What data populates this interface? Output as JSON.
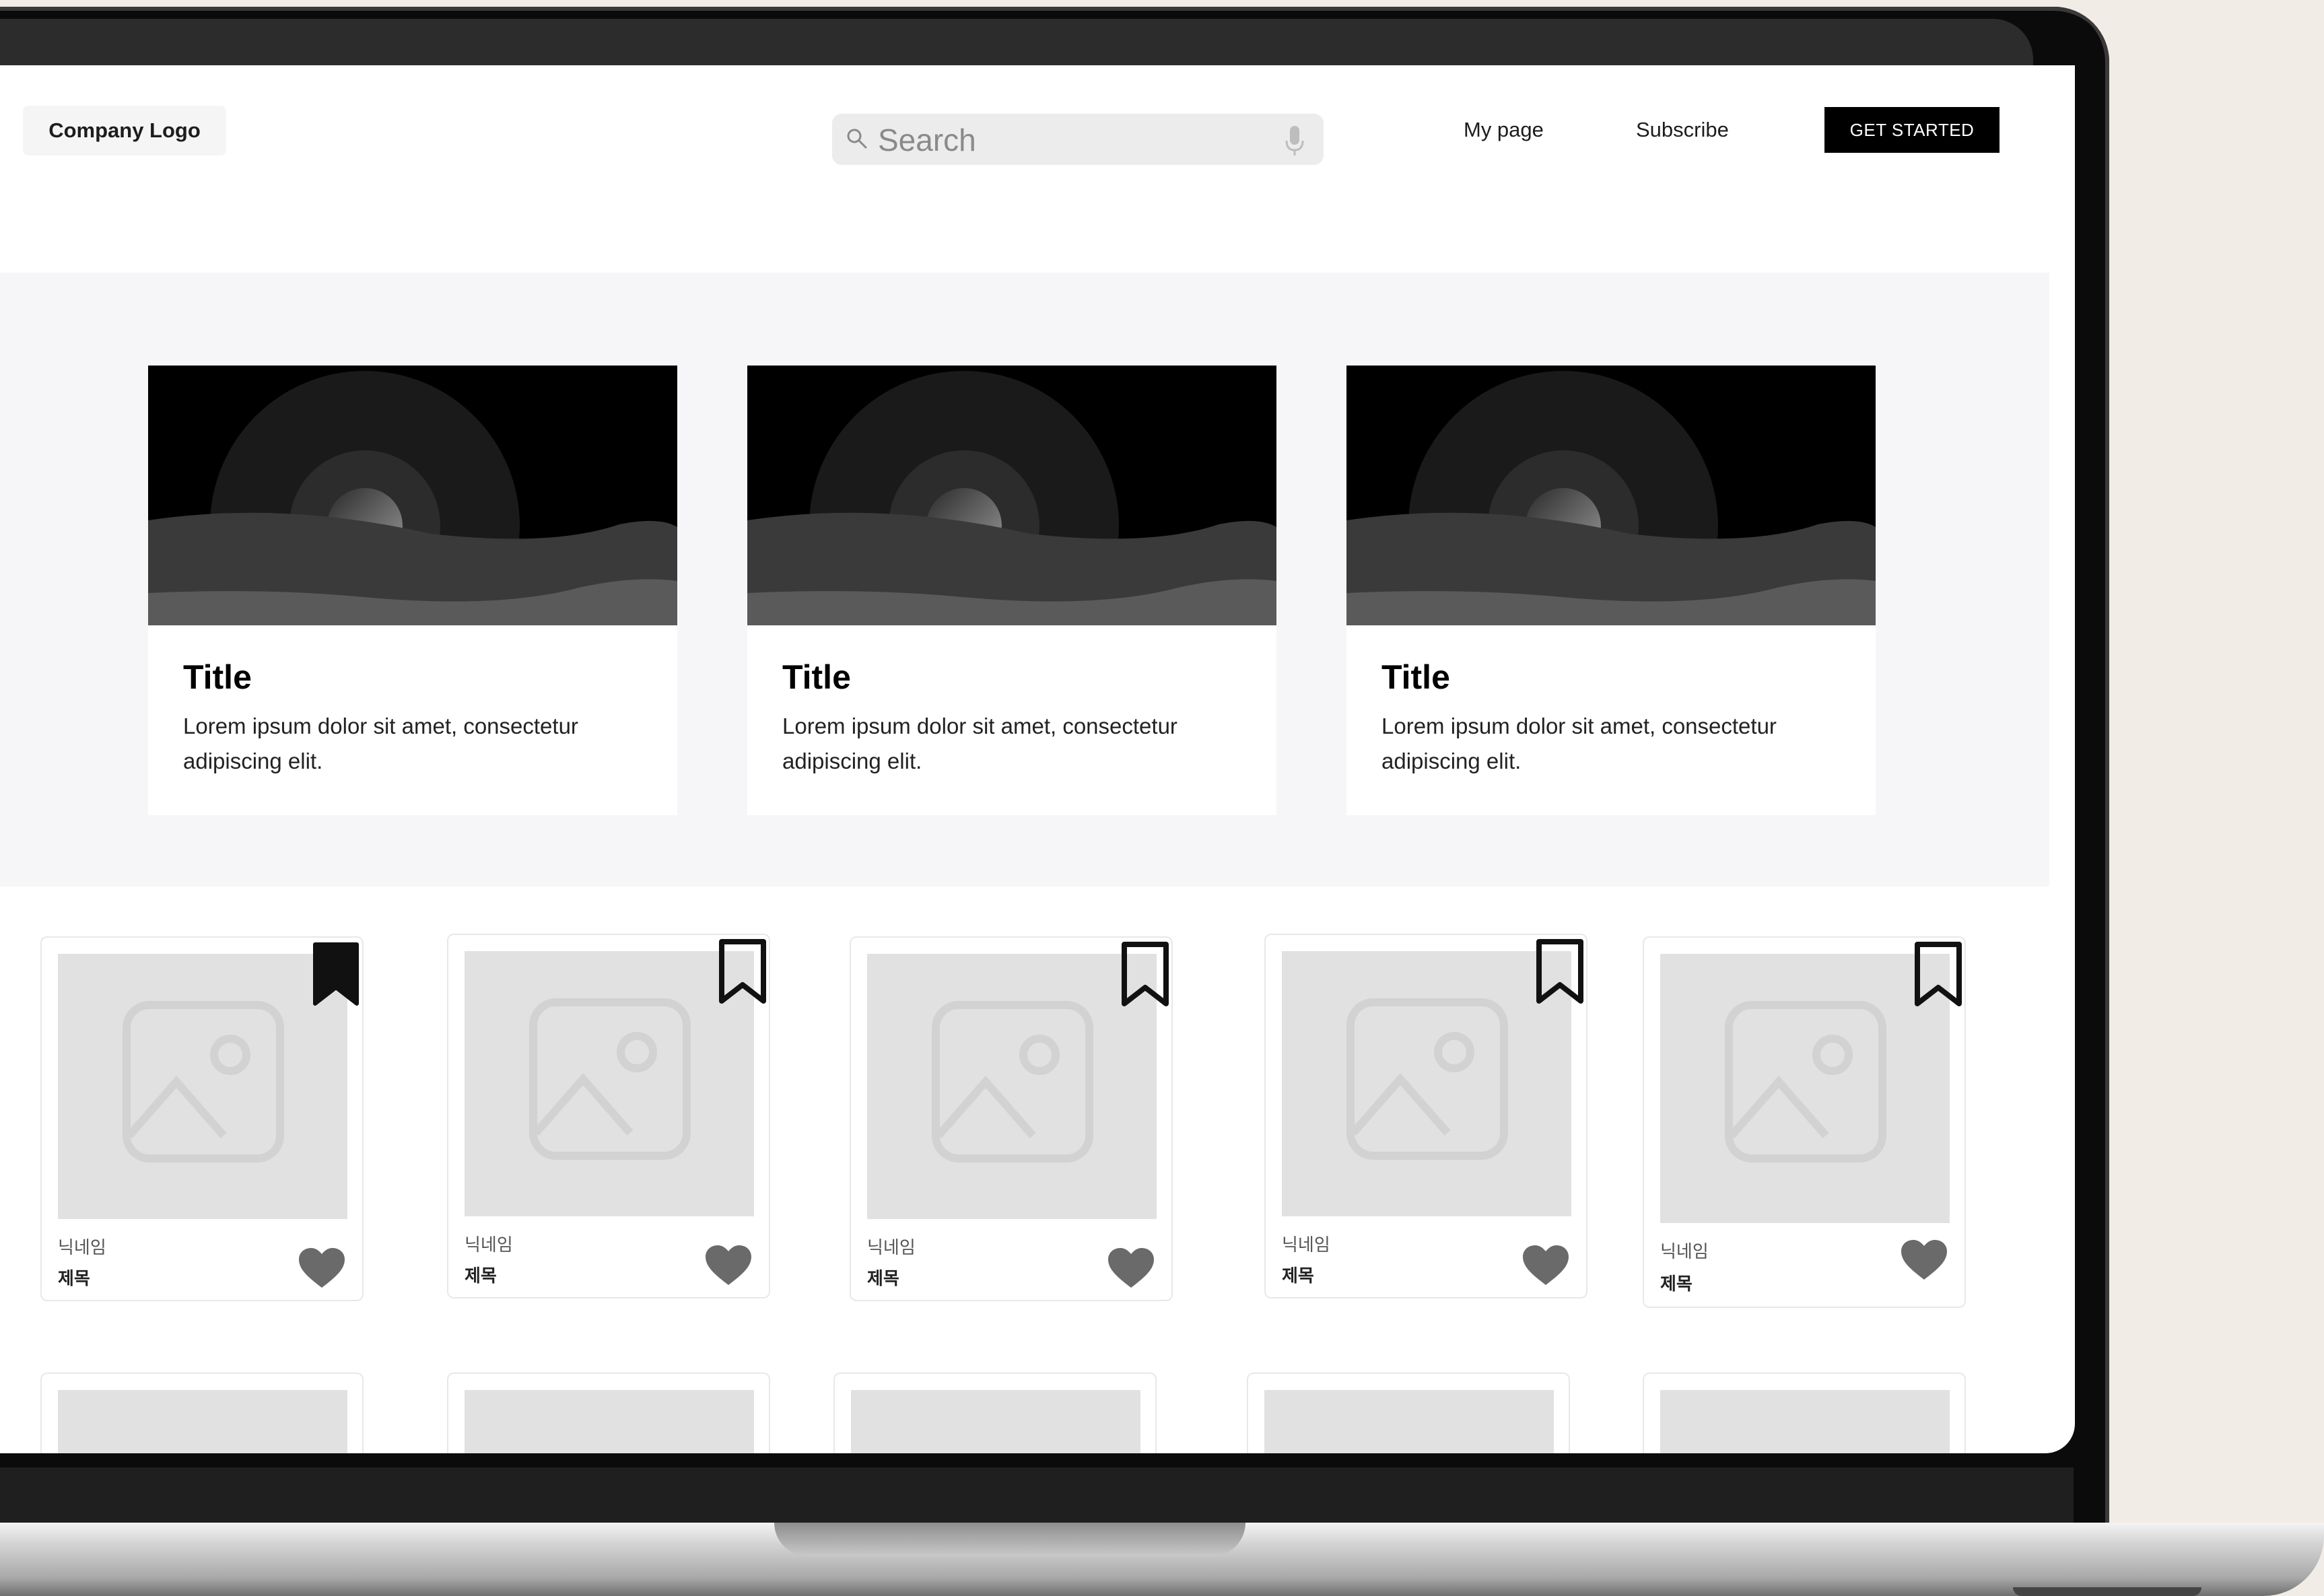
{
  "header": {
    "logo": "Company Logo",
    "search_placeholder": "Search",
    "nav": [
      "My page",
      "Subscribe"
    ],
    "cta": "GET STARTED"
  },
  "features": [
    {
      "title": "Title",
      "description": "Lorem ipsum dolor sit amet, consectetur adipiscing elit."
    },
    {
      "title": "Title",
      "description": "Lorem ipsum dolor sit amet, consectetur adipiscing elit."
    },
    {
      "title": "Title",
      "description": "Lorem ipsum dolor sit amet, consectetur adipiscing elit."
    }
  ],
  "cards": [
    {
      "nickname": "닉네임",
      "title": "제목",
      "bookmarked": true
    },
    {
      "nickname": "닉네임",
      "title": "제목",
      "bookmarked": false
    },
    {
      "nickname": "닉네임",
      "title": "제목",
      "bookmarked": false
    },
    {
      "nickname": "닉네임",
      "title": "제목",
      "bookmarked": false
    },
    {
      "nickname": "닉네임",
      "title": "제목",
      "bookmarked": false
    }
  ],
  "icons": {
    "search": "search-icon",
    "mic": "microphone-icon",
    "bookmark": "bookmark-icon",
    "heart": "heart-icon",
    "image_placeholder": "image-placeholder-icon"
  }
}
